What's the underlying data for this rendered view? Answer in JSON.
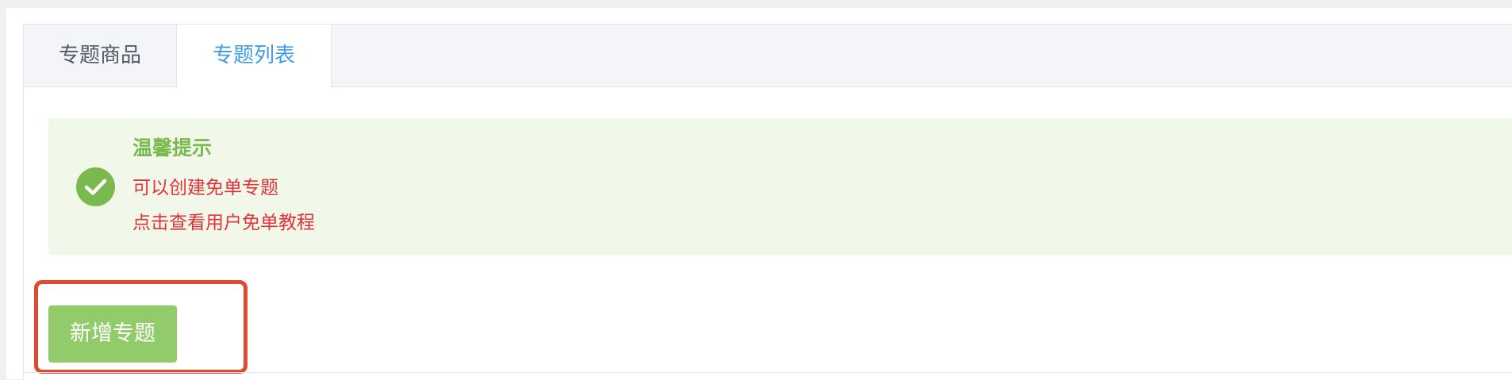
{
  "tabs": [
    {
      "label": "专题商品",
      "active": false
    },
    {
      "label": "专题列表",
      "active": true
    }
  ],
  "tip": {
    "icon": "check-circle-icon",
    "title": "温馨提示",
    "lines": [
      "可以创建免单专题",
      "点击查看用户免单教程"
    ]
  },
  "actions": {
    "add_label": "新增专题"
  },
  "colors": {
    "accent_blue": "#3f9be8",
    "success_green": "#7ab94e",
    "button_green": "#91cb6a",
    "tip_background": "#f1f8ea",
    "warning_red": "#e0343a",
    "highlight_red": "#e04a2f"
  }
}
